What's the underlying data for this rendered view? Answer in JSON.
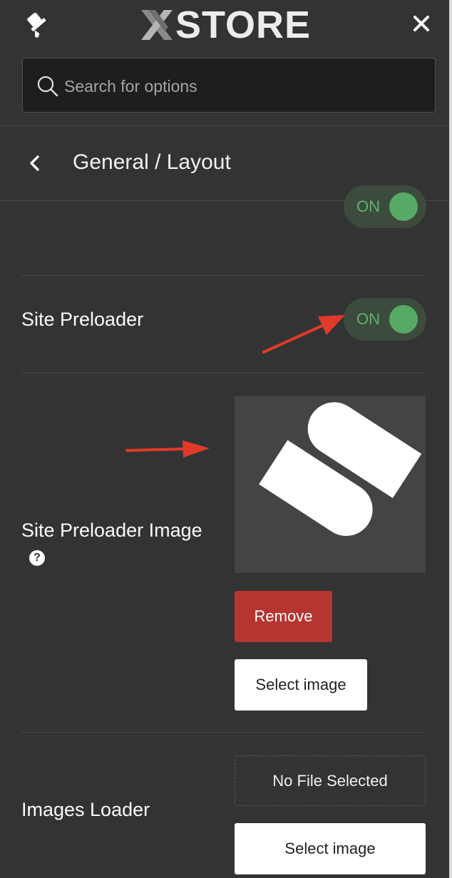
{
  "header": {
    "logo_text": "STORE",
    "search_placeholder": "Search for options"
  },
  "nav": {
    "title": "General / Layout"
  },
  "rows": [
    {
      "toggle_label": "ON",
      "state": "on"
    },
    {
      "label": "Site Preloader",
      "toggle_label": "ON",
      "state": "on"
    },
    {
      "label": "Site Preloader Image",
      "help": "?",
      "remove_label": "Remove",
      "select_label": "Select image"
    },
    {
      "label": "Images Loader",
      "empty_label": "No File Selected",
      "select_label": "Select image"
    }
  ],
  "colors": {
    "panel": "#333333",
    "toggle_on": "#57aa65",
    "remove_button": "#b53530",
    "annotation_arrow": "#e03a2a"
  },
  "icons": [
    "brush-icon",
    "close-icon",
    "search-icon",
    "back-chevron-icon",
    "help-icon",
    "xstore-logo-mark"
  ]
}
